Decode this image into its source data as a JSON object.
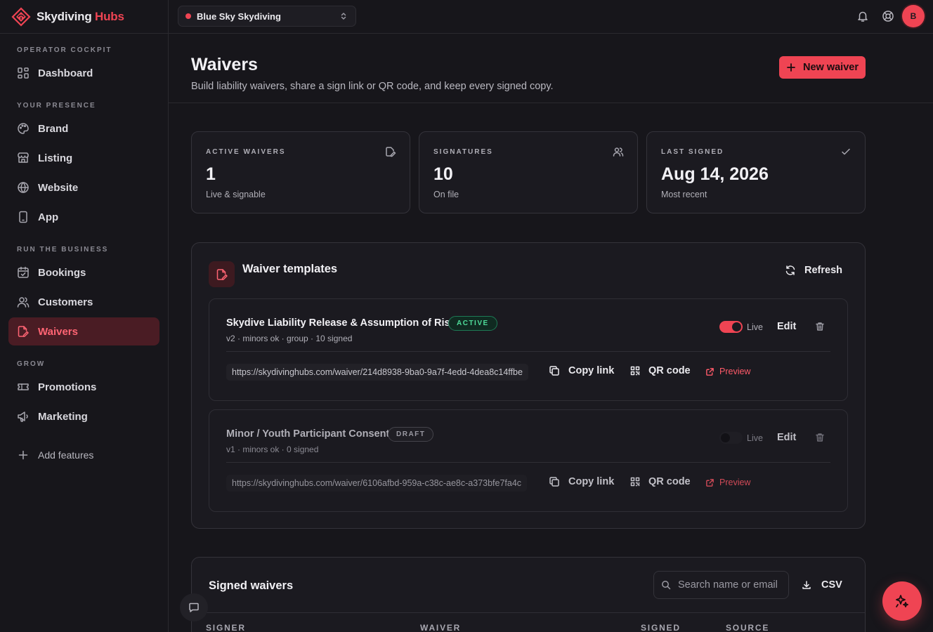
{
  "app": {
    "brand_main": "Skydiving",
    "brand_accent": " Hubs",
    "accent_color": "#ef4453"
  },
  "sidebar": {
    "sections": [
      {
        "label": "OPERATOR COCKPIT"
      },
      {
        "label": "YOUR PRESENCE"
      },
      {
        "label": "RUN THE BUSINESS"
      },
      {
        "label": "GROW"
      }
    ],
    "items": [
      {
        "label": "Dashboard",
        "icon": "dashboard-icon"
      },
      {
        "label": "Brand",
        "icon": "palette-icon"
      },
      {
        "label": "Listing",
        "icon": "store-icon"
      },
      {
        "label": "Website",
        "icon": "globe-icon"
      },
      {
        "label": "App",
        "icon": "phone-icon"
      },
      {
        "label": "Bookings",
        "icon": "calendar-check-icon"
      },
      {
        "label": "Customers",
        "icon": "users-icon"
      },
      {
        "label": "Waivers",
        "icon": "file-signature-icon",
        "active": true
      },
      {
        "label": "Promotions",
        "icon": "ticket-icon"
      },
      {
        "label": "Marketing",
        "icon": "megaphone-icon"
      }
    ],
    "add_features": "Add features"
  },
  "topbar": {
    "operator": "Blue Sky Skydiving",
    "avatar_initial": "B"
  },
  "header": {
    "title": "Waivers",
    "subtitle": "Build liability waivers, share a sign link or QR code, and keep every signed copy.",
    "new_button": "New waiver"
  },
  "stats": [
    {
      "label": "ACTIVE WAIVERS",
      "value": "1",
      "hint": "Live & signable",
      "icon": "edit-icon"
    },
    {
      "label": "SIGNATURES",
      "value": "10",
      "hint": "On file",
      "icon": "users-icon"
    },
    {
      "label": "LAST SIGNED",
      "value": "Aug 14, 2026",
      "hint": "Most recent",
      "icon": "check-icon"
    }
  ],
  "templates_panel": {
    "title": "Waiver templates",
    "refresh": "Refresh",
    "templates": [
      {
        "name": "Skydive Liability Release & Assumption of Risk",
        "status": "ACTIVE",
        "meta": "v2 · minors ok · group · 10 signed",
        "live_label": "Live",
        "live": true,
        "edit": "Edit",
        "url": "https://skydivinghubs.com/waiver/214d8938-9ba0-9a7f-4edd-4dea8c14ffbe",
        "copy_link": "Copy link",
        "qr_code": "QR code",
        "preview": "Preview"
      },
      {
        "name": "Minor / Youth Participant Consent",
        "status": "DRAFT",
        "meta": "v1 · minors ok · 0 signed",
        "live_label": "Live",
        "live": false,
        "edit": "Edit",
        "url": "https://skydivinghubs.com/waiver/6106afbd-959a-c38c-ae8c-a373bfe7fa4c",
        "copy_link": "Copy link",
        "qr_code": "QR code",
        "preview": "Preview"
      }
    ]
  },
  "signed_panel": {
    "title": "Signed waivers",
    "search_placeholder": "Search name or email",
    "csv": "CSV",
    "columns": [
      "SIGNER",
      "WAIVER",
      "SIGNED",
      "SOURCE"
    ]
  }
}
